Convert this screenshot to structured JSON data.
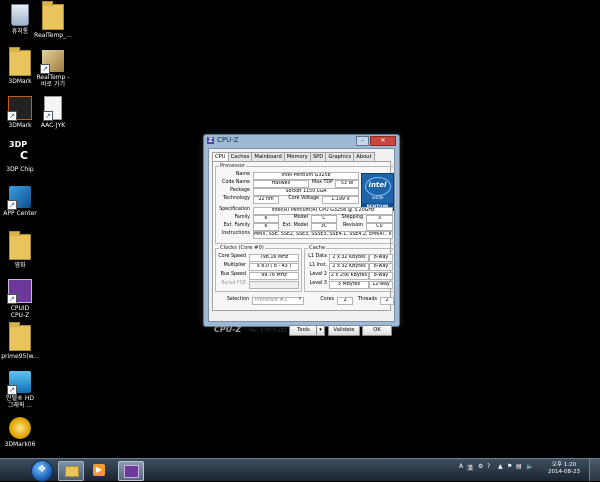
{
  "desktop": {
    "icons": [
      {
        "label": "휴지통"
      },
      {
        "label": "RealTemp_..."
      },
      {
        "label": "3DMark"
      },
      {
        "label": "RealTemp -"
      },
      {
        "label": "바로 가기"
      },
      {
        "label": "3DMark"
      },
      {
        "label": "AAC-JYK"
      },
      {
        "label": "3DP"
      },
      {
        "label": "C"
      },
      {
        "label": "3DP Chip"
      },
      {
        "label": "APP Center"
      },
      {
        "label": "영화"
      },
      {
        "label": "CPUID"
      },
      {
        "label": "CPU-Z"
      },
      {
        "label": "prime95(w..."
      },
      {
        "label": "인텔® HD"
      },
      {
        "label": "그래픽 ..."
      },
      {
        "label": "3DMark06"
      }
    ]
  },
  "window": {
    "title": "CPU-Z",
    "app_icon": "Z",
    "tabs": [
      "CPU",
      "Caches",
      "Mainboard",
      "Memory",
      "SPD",
      "Graphics",
      "About"
    ],
    "processor": {
      "legend": "Processor",
      "name_label": "Name",
      "name": "Intel Pentium G3258",
      "code_label": "Code Name",
      "code": "Haswell",
      "tdp_label": "Max TDP",
      "tdp": "53 W",
      "package_label": "Package",
      "package": "Socket 1150 LGA",
      "tech_label": "Technology",
      "tech": "22 nm",
      "voltage_label": "Core Voltage",
      "voltage": "1.199 V",
      "spec_label": "Specification",
      "spec": "Intel(R) Pentium(R) CPU G3258 @ 3.20GHz",
      "family_label": "Family",
      "family": "6",
      "model_label": "Model",
      "model": "C",
      "stepping_label": "Stepping",
      "stepping": "3",
      "extfamily_label": "Ext. Family",
      "extfamily": "6",
      "extmodel_label": "Ext. Model",
      "extmodel": "3C",
      "revision_label": "Revision",
      "revision": "C0",
      "instr_label": "Instructions",
      "instr": "MMX, SSE, SSE2, SSE3, SSSE3, SSE4.1, SSE4.2, EM64T, VT-x"
    },
    "intel_logo": {
      "brand": "intel",
      "inside": "inside",
      "line": "PENTIUM"
    },
    "clocks": {
      "legend": "Clocks (Core #0)",
      "speed_label": "Core Speed",
      "speed": "798.16 MHz",
      "mult_label": "Multiplier",
      "mult": "x 8.0 ( 8 - 43 )",
      "bus_label": "Bus Speed",
      "bus": "99.76 MHz",
      "fsb_label": "Rated FSB"
    },
    "cache": {
      "legend": "Cache",
      "rows": [
        {
          "label": "L1 Data",
          "value": "2 x 32 KBytes",
          "way": "8-way"
        },
        {
          "label": "L1 Inst.",
          "value": "2 x 32 KBytes",
          "way": "8-way"
        },
        {
          "label": "Level 2",
          "value": "2 x 256 KBytes",
          "way": "8-way"
        },
        {
          "label": "Level 3",
          "value": "3 MBytes",
          "way": "12-way"
        }
      ]
    },
    "selection": {
      "label": "Selection",
      "value": "Processor #1",
      "cores_label": "Cores",
      "cores": "2",
      "threads_label": "Threads",
      "threads": "2"
    },
    "footer": {
      "brand": "CPU-Z",
      "version": "Ver. 1.70.0.x32",
      "tools": "Tools",
      "validate": "Validate",
      "ok": "OK"
    }
  },
  "taskbar": {
    "tray_a": "A",
    "tray_lang": "漢",
    "time": "오후 1:20",
    "date": "2014-08-23"
  }
}
